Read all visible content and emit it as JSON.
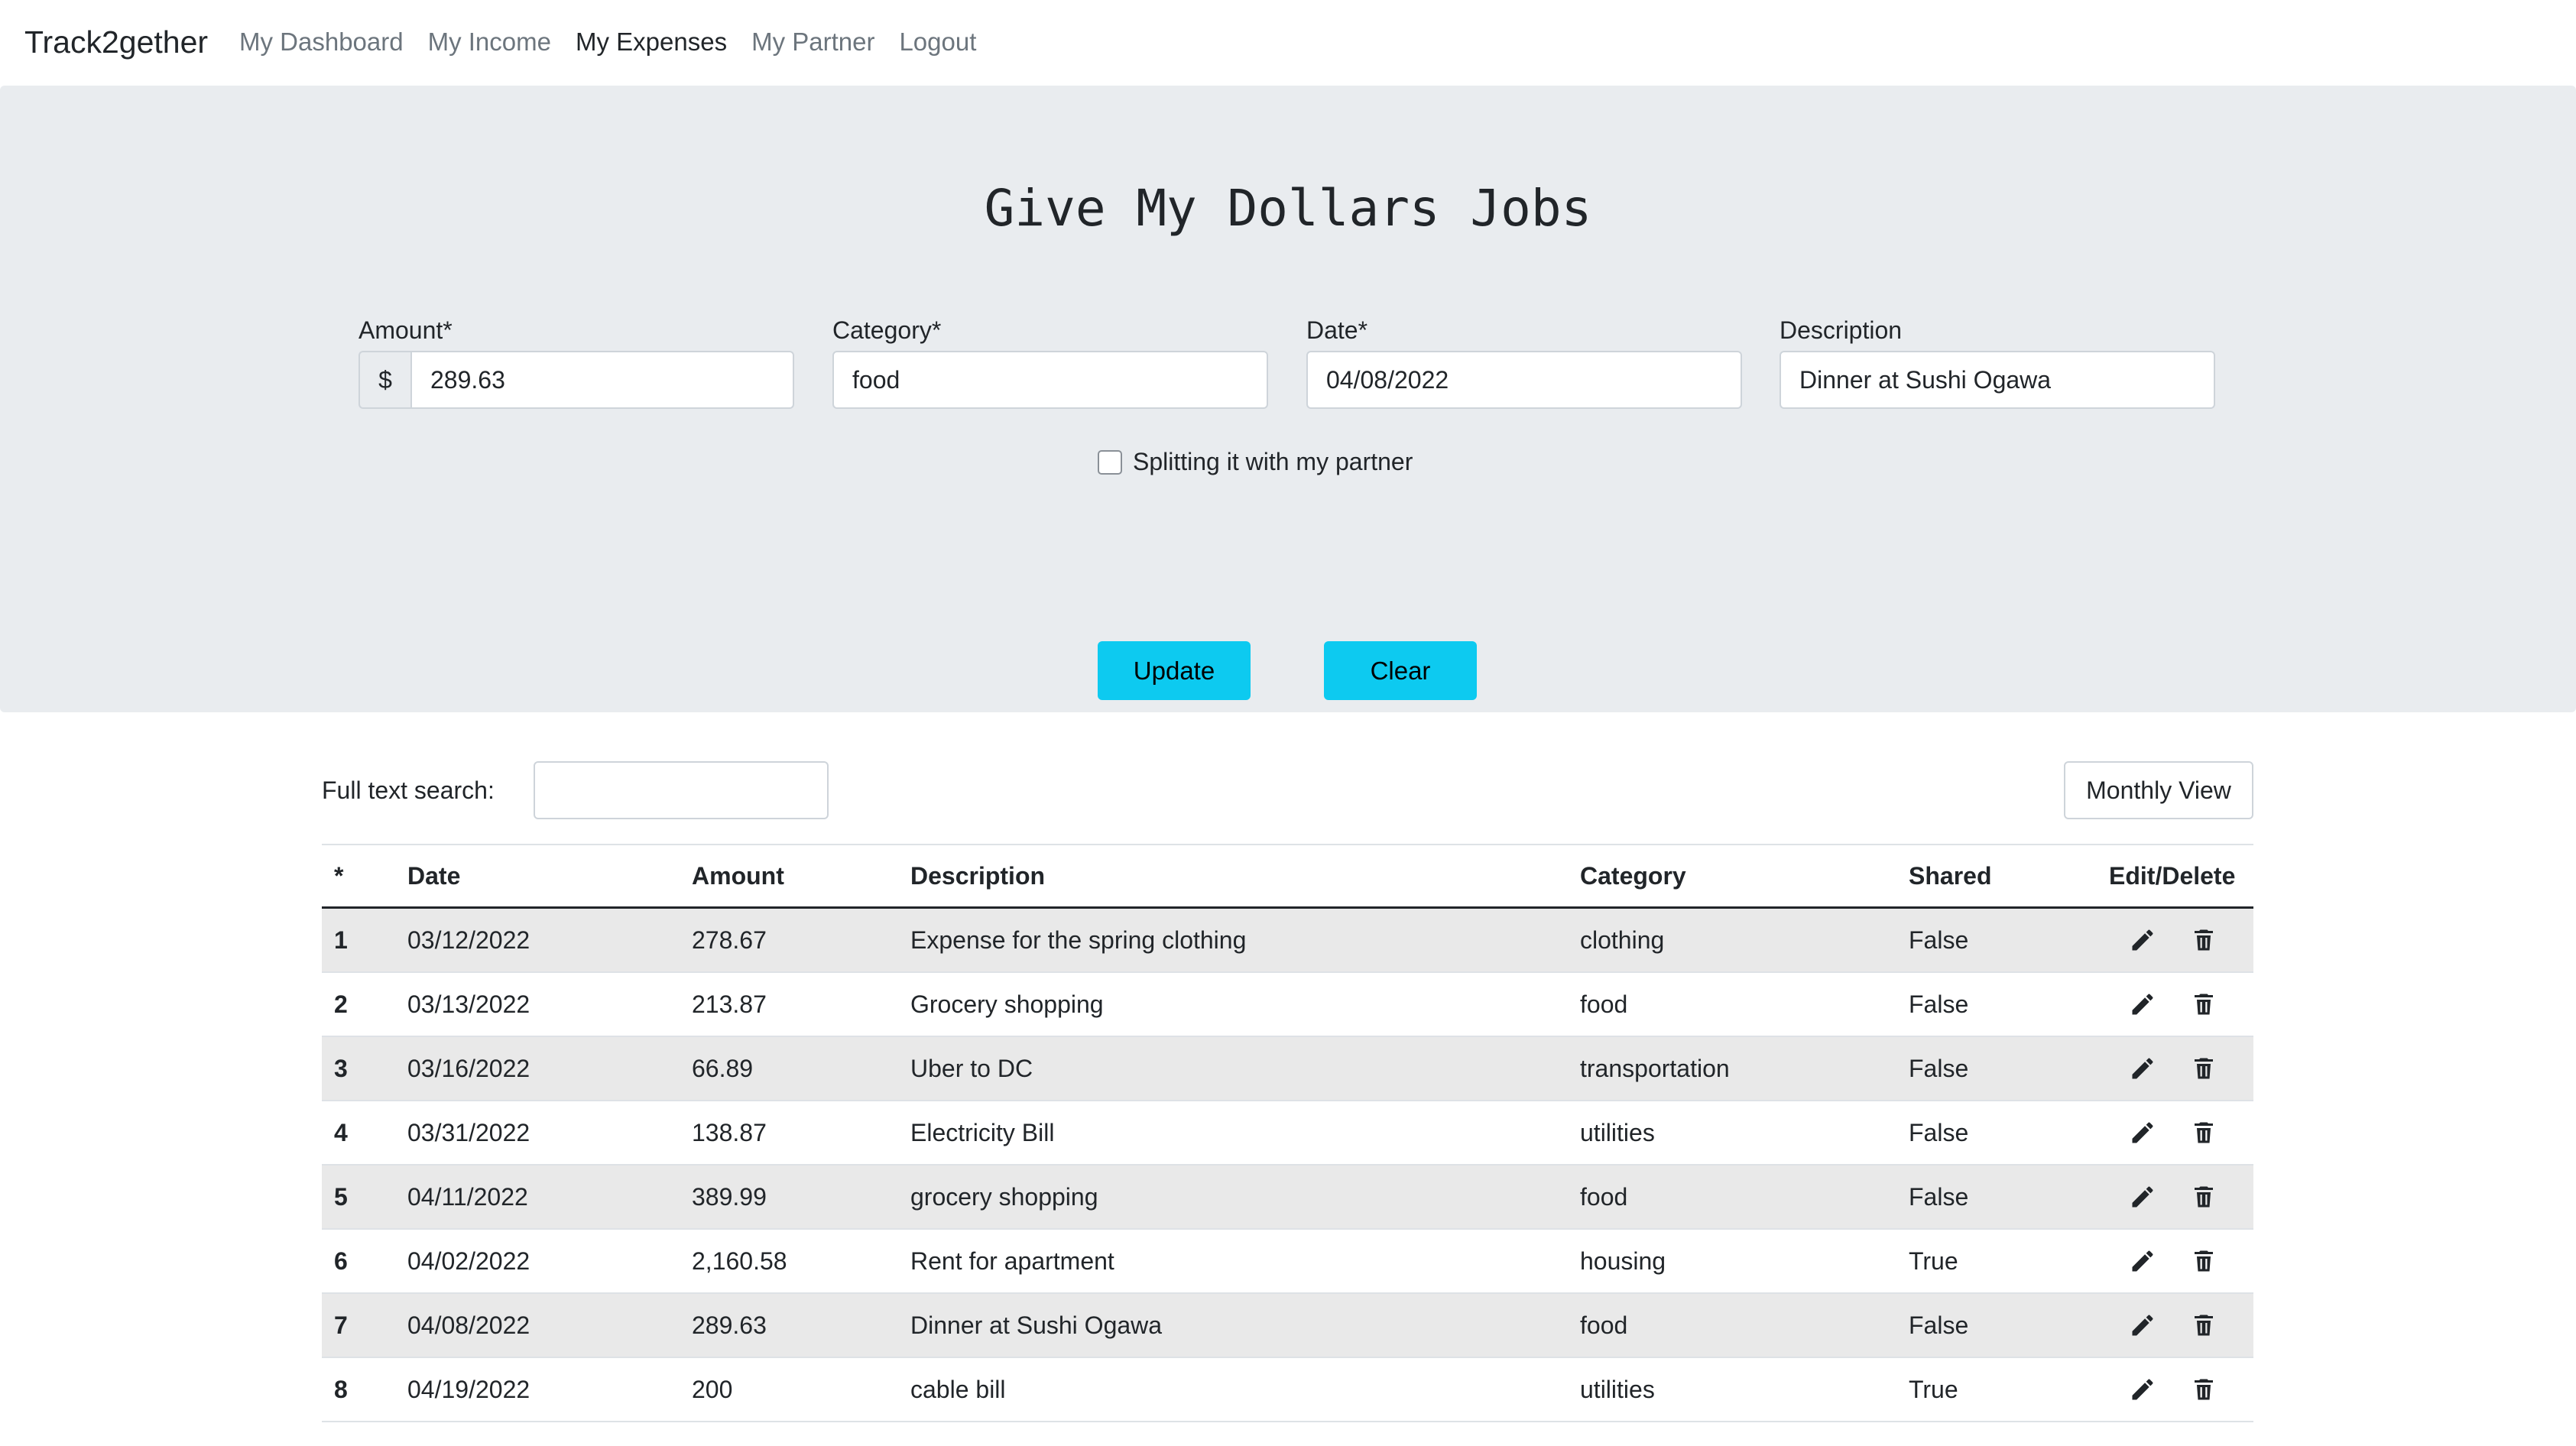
{
  "navbar": {
    "brand": "Track2gether",
    "links": [
      "My Dashboard",
      "My Income",
      "My Expenses",
      "My Partner",
      "Logout"
    ]
  },
  "form": {
    "title": "Give My Dollars Jobs",
    "amount_label": "Amount*",
    "currency_prefix": "$",
    "amount_value": "289.63",
    "category_label": "Category*",
    "category_value": "food",
    "date_label": "Date*",
    "date_value": "04/08/2022",
    "description_label": "Description",
    "description_value": "Dinner at Sushi Ogawa",
    "split_label": "Splitting it with my partner",
    "update_label": "Update",
    "clear_label": "Clear"
  },
  "table": {
    "search_label": "Full text search:",
    "monthly_view_label": "Monthly View",
    "headers": [
      "*",
      "Date",
      "Amount",
      "Description",
      "Category",
      "Shared",
      "Edit/Delete"
    ],
    "rows": [
      [
        "1",
        "03/12/2022",
        "278.67",
        "Expense for the spring clothing",
        "clothing",
        "False"
      ],
      [
        "2",
        "03/13/2022",
        "213.87",
        "Grocery shopping",
        "food",
        "False"
      ],
      [
        "3",
        "03/16/2022",
        "66.89",
        "Uber to DC",
        "transportation",
        "False"
      ],
      [
        "4",
        "03/31/2022",
        "138.87",
        "Electricity Bill",
        "utilities",
        "False"
      ],
      [
        "5",
        "04/11/2022",
        "389.99",
        "grocery shopping",
        "food",
        "False"
      ],
      [
        "6",
        "04/02/2022",
        "2,160.58",
        "Rent for apartment",
        "housing",
        "True"
      ],
      [
        "7",
        "04/08/2022",
        "289.63",
        "Dinner at Sushi Ogawa",
        "food",
        "False"
      ],
      [
        "8",
        "04/19/2022",
        "200",
        "cable bill",
        "utilities",
        "True"
      ]
    ]
  },
  "colors": {
    "accent_button": "#0dcaf0",
    "hero_background": "#e9ecef",
    "stripe": "#e9e9e9"
  },
  "icons": {
    "edit": "pencil-icon",
    "delete": "trash-icon"
  }
}
